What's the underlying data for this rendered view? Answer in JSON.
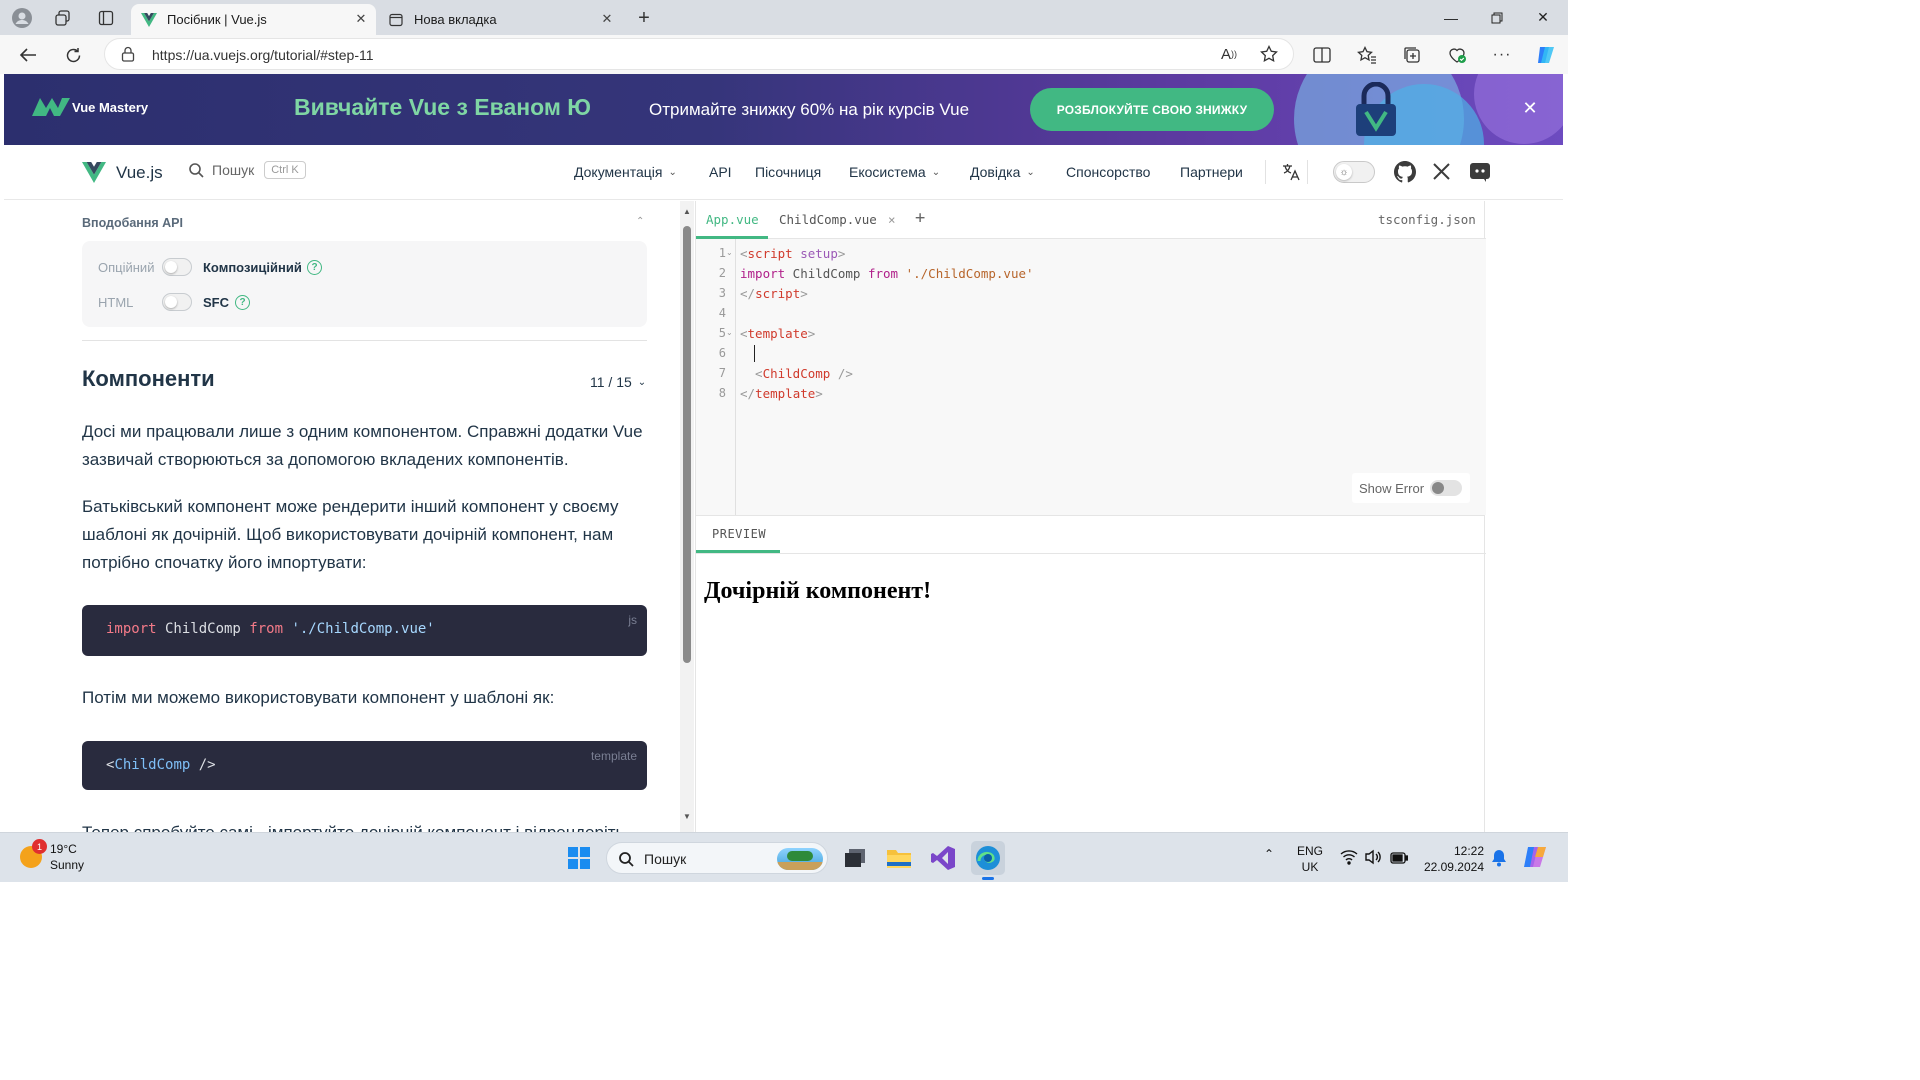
{
  "browser": {
    "tabs": [
      {
        "title": "Посібник | Vue.js",
        "active": true
      },
      {
        "title": "Нова вкладка",
        "active": false
      }
    ],
    "new_tab_symbol": "+",
    "url": "https://ua.vuejs.org/tutorial/#step-11",
    "read_aloud_label": "A",
    "icons": [
      "profile-icon",
      "workspaces-icon",
      "tab-actions-icon",
      "back-icon",
      "refresh-icon",
      "lock-icon",
      "read-aloud-icon",
      "favorite-star-icon",
      "split-screen-icon",
      "favorites-icon",
      "collections-icon",
      "browser-essentials-icon",
      "more-icon",
      "copilot-icon"
    ]
  },
  "banner": {
    "logo_text": "Vue Mastery",
    "title": "Вивчайте Vue з Еваном Ю",
    "subtitle": "Отримайте знижку 60% на рік курсів Vue",
    "cta": "РОЗБЛОКУЙТЕ СВОЮ ЗНИЖКУ",
    "close": "✕"
  },
  "site_nav": {
    "brand": "Vue.js",
    "search_label": "Пошук",
    "search_shortcut": "Ctrl K",
    "links": [
      {
        "label": "Документація",
        "dropdown": true
      },
      {
        "label": "API",
        "dropdown": false
      },
      {
        "label": "Пісочниця",
        "dropdown": false
      },
      {
        "label": "Екосистема",
        "dropdown": true
      },
      {
        "label": "Довідка",
        "dropdown": true
      },
      {
        "label": "Спонсорство",
        "dropdown": false
      },
      {
        "label": "Партнери",
        "dropdown": false
      }
    ],
    "icons": [
      "translate-icon",
      "theme-toggle-icon",
      "github-icon",
      "x-twitter-icon",
      "discord-icon"
    ]
  },
  "tutorial": {
    "prefs_title": "Вподобання API",
    "pref_api_off": "Опційний",
    "pref_api_on": "Композиційний",
    "pref_fmt_off": "HTML",
    "pref_fmt_on": "SFC",
    "help_symbol": "?",
    "lesson_title": "Компоненти",
    "step_label": "11 / 15",
    "para1": "Досі ми працювали лише з одним компонентом. Справжні додатки Vue зазвичай створюються за допомогою вкладених компонентів.",
    "para2": "Батьківський компонент може рендерити інший компонент у своєму шаблоні як дочірній. Щоб використовувати дочірній компонент, нам потрібно спочатку його імпортувати:",
    "code1": {
      "kw1": "import",
      "id": " ChildComp ",
      "kw2": "from",
      "str": " './ChildComp.vue'",
      "lang": "js"
    },
    "para3": "Потім ми можемо використовувати компонент у шаблоні як:",
    "code2": {
      "open": "<",
      "tag": "ChildComp",
      "close": " />",
      "lang": "template"
    },
    "para4_partial": "Тепер спробуйте самі - імпортуйте дочірній компонент і відрендеріть"
  },
  "editor": {
    "tabs": [
      {
        "label": "App.vue",
        "active": true
      },
      {
        "label": "ChildComp.vue",
        "active": false,
        "closable": true
      }
    ],
    "close_symbol": "×",
    "add_tab": "+",
    "right_tab": "tsconfig.json",
    "line_numbers": [
      "1",
      "2",
      "3",
      "4",
      "5",
      "6",
      "7",
      "8"
    ],
    "lines": [
      [
        {
          "t": "<",
          "c": "c-brk"
        },
        {
          "t": "script",
          "c": "c-tag"
        },
        {
          "t": " setup",
          "c": "c-attr"
        },
        {
          "t": ">",
          "c": "c-brk"
        }
      ],
      [
        {
          "t": "import",
          "c": "c-kw"
        },
        {
          "t": " ChildComp ",
          "c": "c-id"
        },
        {
          "t": "from",
          "c": "c-kw"
        },
        {
          "t": " './ChildComp.vue'",
          "c": "c-str"
        }
      ],
      [
        {
          "t": "</",
          "c": "c-brk"
        },
        {
          "t": "script",
          "c": "c-tag"
        },
        {
          "t": ">",
          "c": "c-brk"
        }
      ],
      [],
      [
        {
          "t": "<",
          "c": "c-brk"
        },
        {
          "t": "template",
          "c": "c-tag"
        },
        {
          "t": ">",
          "c": "c-brk"
        }
      ],
      [],
      [
        {
          "t": "  <",
          "c": "c-brk"
        },
        {
          "t": "ChildComp",
          "c": "c-comp"
        },
        {
          "t": " />",
          "c": "c-brk"
        }
      ],
      [
        {
          "t": "</",
          "c": "c-brk"
        },
        {
          "t": "template",
          "c": "c-tag"
        },
        {
          "t": ">",
          "c": "c-brk"
        }
      ]
    ],
    "show_error_label": "Show Error",
    "preview_tab": "PREVIEW",
    "preview_heading": "Дочірній компонент!"
  },
  "taskbar": {
    "weather_temp": "19°C",
    "weather_desc": "Sunny",
    "weather_badge": "1",
    "search_placeholder": "Пошук",
    "lang_top": "ENG",
    "lang_bottom": "UK",
    "time": "12:22",
    "date": "22.09.2024",
    "colors": {
      "accent": "#42b883",
      "brand_dark": "#213547"
    }
  }
}
